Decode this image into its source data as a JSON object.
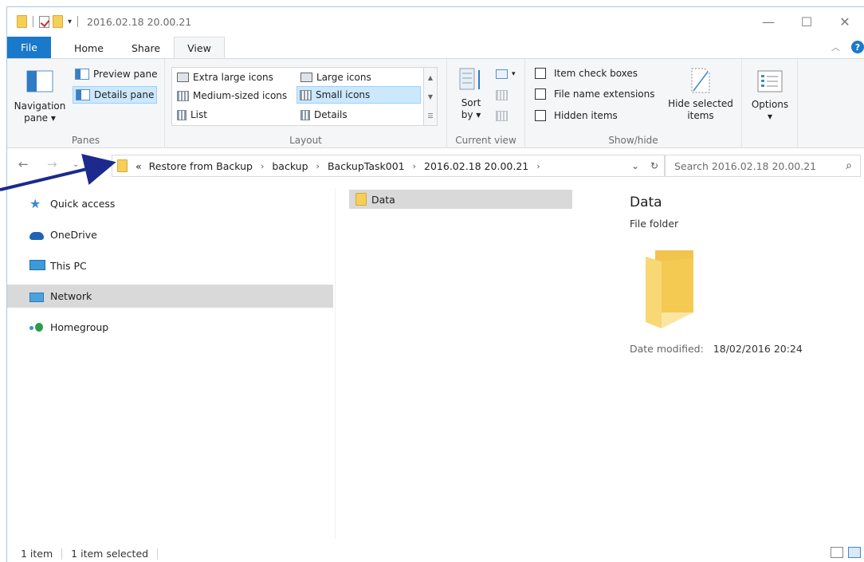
{
  "window": {
    "title": "2016.02.18 20.00.21",
    "minimize_glyph": "—",
    "maximize_glyph": "☐",
    "close_glyph": "✕"
  },
  "tabs": [
    {
      "label": "File"
    },
    {
      "label": "Home"
    },
    {
      "label": "Share"
    },
    {
      "label": "View"
    }
  ],
  "ribbon": {
    "panes_group": {
      "label": "Panes",
      "navigation_pane": "Navigation",
      "navigation_pane_2": "pane ▾",
      "preview_pane": "Preview pane",
      "details_pane": "Details pane"
    },
    "layout_group": {
      "label": "Layout",
      "items": [
        {
          "label": "Extra large icons"
        },
        {
          "label": "Large icons"
        },
        {
          "label": "Medium-sized icons"
        },
        {
          "label": "Small icons"
        },
        {
          "label": "List"
        },
        {
          "label": "Details"
        }
      ]
    },
    "current_view_group": {
      "label": "Current view",
      "sort_by": "Sort",
      "sort_by_2": "by ▾"
    },
    "show_hide_group": {
      "label": "Show/hide",
      "item_check_boxes": "Item check boxes",
      "file_name_extensions": "File name extensions",
      "hidden_items": "Hidden items",
      "hide_selected": "Hide selected",
      "hide_selected_2": "items"
    },
    "options": {
      "label": "Options",
      "label_2": "▾"
    }
  },
  "address": {
    "overflow": "«",
    "crumbs": [
      "Restore from Backup",
      "backup",
      "BackupTask001",
      "2016.02.18 20.00.21"
    ],
    "search_placeholder": "Search 2016.02.18 20.00.21"
  },
  "nav_pane": {
    "items": [
      {
        "label": "Quick access"
      },
      {
        "label": "OneDrive"
      },
      {
        "label": "This PC"
      },
      {
        "label": "Network"
      },
      {
        "label": "Homegroup"
      }
    ]
  },
  "files": [
    {
      "name": "Data"
    }
  ],
  "details_pane": {
    "title": "Data",
    "type": "File folder",
    "date_label": "Date modified:",
    "date_value": "18/02/2016 20:24"
  },
  "status": {
    "count": "1 item",
    "selected": "1 item selected"
  },
  "colors": {
    "file_tab": "#1979ca",
    "selection": "#cce8ff",
    "arrow": "#1b2a8c",
    "folder": "#f6cf57"
  }
}
